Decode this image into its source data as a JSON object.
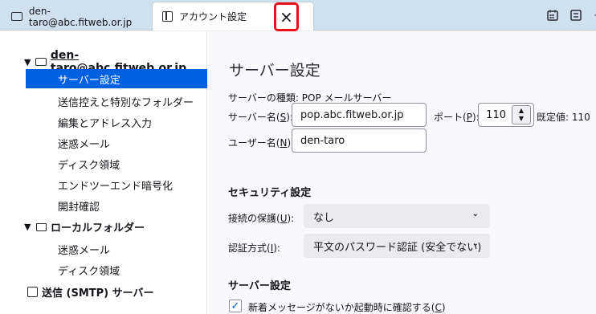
{
  "tabs": {
    "mail_tab_label": "den-taro@abc.fitweb.or.jp",
    "settings_tab_label": "アカウント設定",
    "close_glyph": "×"
  },
  "toolbar": {
    "minimize_glyph": "–"
  },
  "sidebar": {
    "account": "den-taro@abc.fitweb.or.jp",
    "account_items": [
      "サーバー設定",
      "送信控えと特別なフォルダー",
      "編集とアドレス入力",
      "迷惑メール",
      "ディスク領域",
      "エンドツーエンド暗号化",
      "開封確認"
    ],
    "selected_item": "サーバー設定",
    "local_folders": "ローカルフォルダー",
    "local_items": [
      "迷惑メール",
      "ディスク領域"
    ],
    "smtp": "送信 (SMTP) サーバー"
  },
  "main": {
    "title": "サーバー設定",
    "server_type_label": "サーバーの種類:",
    "server_type_value": "POP メールサーバー",
    "server_name_label": "サーバー名(",
    "server_name_key": "S",
    "server_name_value": "pop.abc.fitweb.or.jp",
    "port_label": "ポート(",
    "port_key": "P",
    "port_value": "110",
    "default_label": "既定値:",
    "default_value": "110",
    "username_label": "ユーザー名(",
    "username_key": "N",
    "username_value": "den-taro",
    "security_heading": "セキュリティ設定",
    "connection_label": "接続の保護(",
    "connection_key": "U",
    "connection_value": "なし",
    "auth_label": "認証方式(",
    "auth_key": "I",
    "auth_value": "平文のパスワード認証 (安全でない)",
    "server_settings_heading": "サーバー設定",
    "check_new_label": "新着メッセージがないか起動時に確認する(",
    "check_new_key": "C",
    "check_new_checked": true
  },
  "colors": {
    "tabbar_bg": "#cfe0ef",
    "selection": "#0061e0",
    "highlight_border": "#e8101a"
  }
}
